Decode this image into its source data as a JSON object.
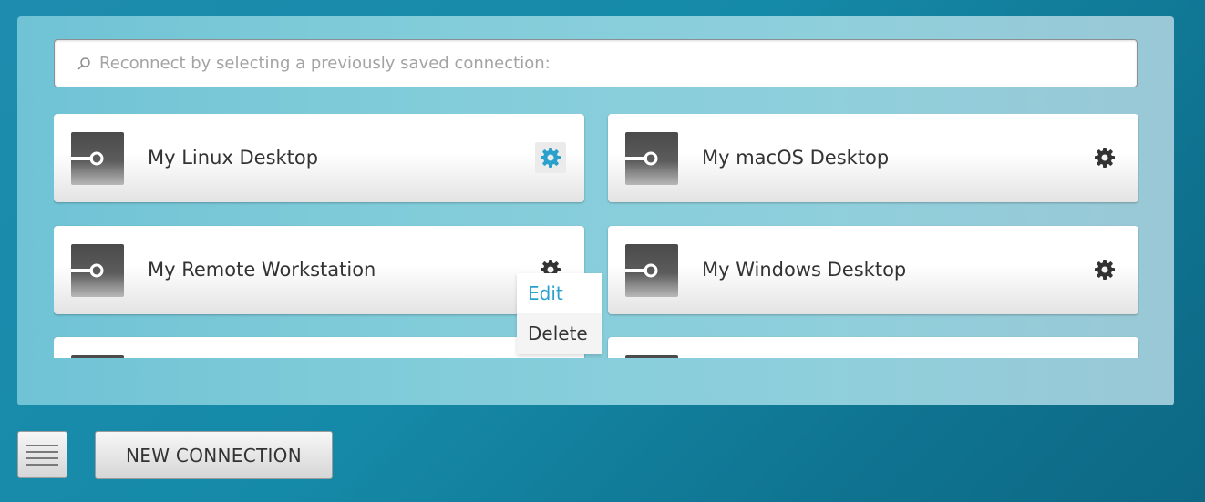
{
  "search": {
    "placeholder": "Reconnect by selecting a previously saved connection:",
    "value": ""
  },
  "connections": [
    {
      "name": "My Linux Desktop",
      "gear_color": "#2aa0cc"
    },
    {
      "name": "My macOS Desktop",
      "gear_color": "#333333"
    },
    {
      "name": "My Remote Workstation",
      "gear_color": "#333333"
    },
    {
      "name": "My Windows Desktop",
      "gear_color": "#333333"
    },
    {
      "name": "",
      "gear_color": "#333333"
    },
    {
      "name": "",
      "gear_color": "#333333"
    }
  ],
  "context_menu": {
    "items": [
      {
        "label": "Edit",
        "highlighted": true
      },
      {
        "label": "Delete",
        "highlighted": false
      }
    ]
  },
  "footer": {
    "menu_icon": "hamburger-icon",
    "new_connection_label": "NEW CONNECTION"
  },
  "colors": {
    "accent": "#2aa0cc",
    "background": "#158aa8",
    "panel": "#82ccda"
  }
}
